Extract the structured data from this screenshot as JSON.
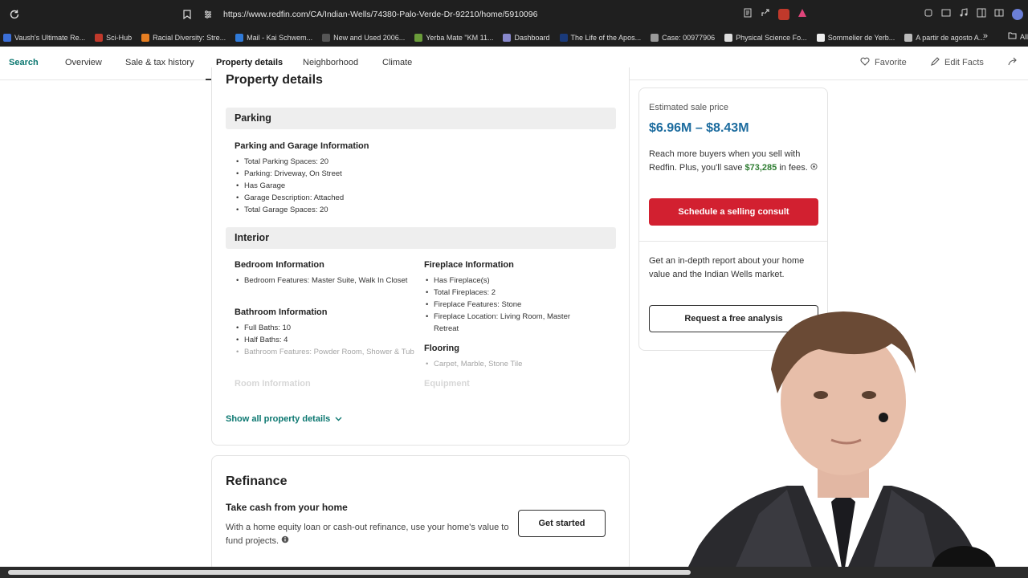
{
  "browser": {
    "url": "https://www.redfin.com/CA/Indian-Wells/74380-Palo-Verde-Dr-92210/home/5910096",
    "bookmarks": [
      {
        "label": "Vaush's Ultimate Re...",
        "color": "#3b6fd8"
      },
      {
        "label": "Sci-Hub",
        "color": "#c0392b"
      },
      {
        "label": "Racial Diversity: Stre...",
        "color": "#e67e22"
      },
      {
        "label": "Mail - Kai Schwem...",
        "color": "#2f7ad8"
      },
      {
        "label": "New and Used 2006...",
        "color": "#555555"
      },
      {
        "label": "Yerba Mate \"KM 11...",
        "color": "#6a9c3a"
      },
      {
        "label": "Dashboard",
        "color": "#8888cc"
      },
      {
        "label": "The Life of the Apos...",
        "color": "#1a3a7a"
      },
      {
        "label": "Case: 00977906",
        "color": "#999999"
      },
      {
        "label": "Physical Science Fo...",
        "color": "#dddddd"
      },
      {
        "label": "Sommelier de Yerb...",
        "color": "#eeeeee"
      },
      {
        "label": "A partir de agosto A...",
        "color": "#bbbbbb"
      }
    ],
    "all_bookmarks_label": "All"
  },
  "nav": {
    "search": "Search",
    "tabs": [
      "Overview",
      "Sale & tax history",
      "Property details",
      "Neighborhood",
      "Climate"
    ],
    "favorite": "Favorite",
    "edit_facts": "Edit Facts"
  },
  "property_details": {
    "title": "Property details",
    "parking": {
      "section": "Parking",
      "heading": "Parking and Garage Information",
      "items": [
        "Total Parking Spaces: 20",
        "Parking: Driveway, On Street",
        "Has Garage",
        "Garage Description: Attached",
        "Total Garage Spaces: 20"
      ]
    },
    "interior": {
      "section": "Interior",
      "bedroom": {
        "heading": "Bedroom Information",
        "items": [
          "Bedroom Features: Master Suite, Walk In Closet"
        ]
      },
      "bathroom": {
        "heading": "Bathroom Information",
        "items": [
          "Full Baths: 10",
          "Half Baths: 4",
          "Bathroom Features: Powder Room, Shower & Tub"
        ]
      },
      "room": {
        "heading": "Room Information"
      },
      "fireplace": {
        "heading": "Fireplace Information",
        "items": [
          "Has Fireplace(s)",
          "Total Fireplaces: 2",
          "Fireplace Features: Stone",
          "Fireplace Location: Living Room, Master Retreat"
        ]
      },
      "flooring": {
        "heading": "Flooring",
        "items": [
          "Carpet, Marble, Stone Tile"
        ]
      },
      "equipment": {
        "heading": "Equipment"
      }
    },
    "show_all": "Show all property details"
  },
  "refinance": {
    "title": "Refinance",
    "subtitle": "Take cash from your home",
    "body": "With a home equity loan or cash-out refinance, use your home's value to fund projects.",
    "button": "Get started"
  },
  "sidebar": {
    "est_label": "Estimated sale price",
    "est_price": "$6.96M – $8.43M",
    "reach_text": "Reach more buyers when you sell with Redfin. Plus, you'll save",
    "save_amount": "$73,285",
    "fees_text": "in fees.",
    "schedule_button": "Schedule a selling consult",
    "report_text": "Get an in-depth report about your home value and the Indian Wells market.",
    "request_button": "Request a free analysis"
  },
  "colors": {
    "accent_green": "#0b7770",
    "price_blue": "#1b6b9e",
    "cta_red": "#d22030",
    "save_green": "#2e7d32"
  }
}
